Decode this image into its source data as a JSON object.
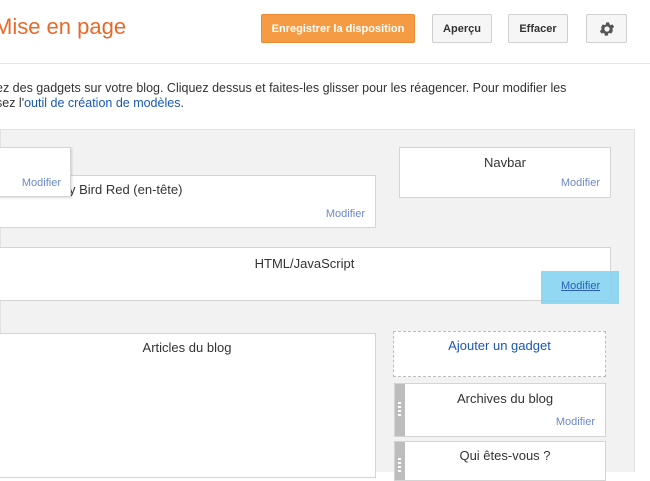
{
  "header": {
    "title": "Mise en page",
    "save_label": "Enregistrer la disposition",
    "preview_label": "Aperçu",
    "clear_label": "Effacer",
    "settings_icon": "gear-icon"
  },
  "description": {
    "line1": "ez des gadgets sur votre blog. Cliquez dessus et faites-les glisser pour les réagencer. Pour modifier les",
    "line2_prefix": "sez l'",
    "line2_link": "outil de création de modèles",
    "line2_suffix": "."
  },
  "gadgets": {
    "header_partial": {
      "modify": "Modifier"
    },
    "header_title": {
      "title": "y Bird Red (en-tête)",
      "modify": "Modifier"
    },
    "navbar": {
      "title": "Navbar",
      "modify": "Modifier"
    },
    "html_js": {
      "title": "HTML/JavaScript",
      "modify": "Modifier"
    },
    "blog_posts": {
      "title": "Articles du blog"
    },
    "add_gadget": {
      "label": "Ajouter un gadget"
    },
    "archives": {
      "title": "Archives du blog",
      "modify": "Modifier"
    },
    "about": {
      "title": "Qui êtes-vous ?"
    }
  }
}
